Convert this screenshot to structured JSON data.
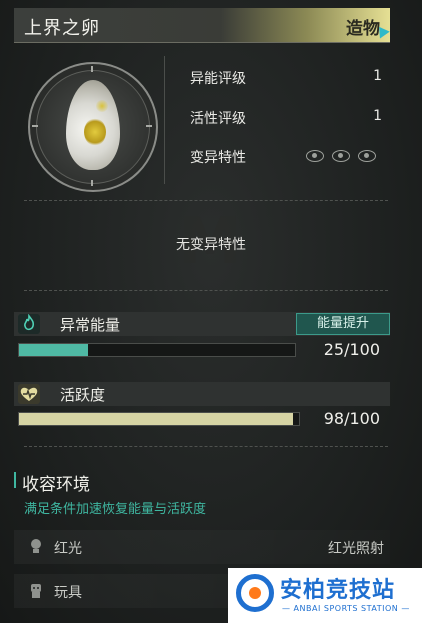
{
  "header": {
    "title": "上界之卵",
    "category": "造物"
  },
  "stats": [
    {
      "label": "异能评级",
      "value": "1"
    },
    {
      "label": "活性评级",
      "value": "1"
    },
    {
      "label": "变异特性",
      "icon": "eye-icon"
    }
  ],
  "mutation_text": "无变异特性",
  "energy": {
    "title": "异常能量",
    "boost_label": "能量提升",
    "value_text": "25/100",
    "fraction": 0.25,
    "icon": "flame-icon",
    "color": "#4fb9a4"
  },
  "activity": {
    "title": "活跃度",
    "value_text": "98/100",
    "fraction": 0.98,
    "icon": "heart-pulse-icon",
    "color": "#d6d4a4"
  },
  "environment": {
    "title": "收容环境",
    "subtitle": "满足条件加速恢复能量与活跃度",
    "rows": [
      {
        "icon": "lightbulb-icon",
        "label": "红光",
        "value": "红光照射"
      },
      {
        "icon": "toy-icon",
        "label": "玩具",
        "value": ""
      }
    ]
  },
  "logo": {
    "name": "安柏竞技站",
    "tagline": "— ANBAI SPORTS STATION —"
  },
  "colors": {
    "accent": "#3fb7a1",
    "header_gold": "#e6e094"
  }
}
